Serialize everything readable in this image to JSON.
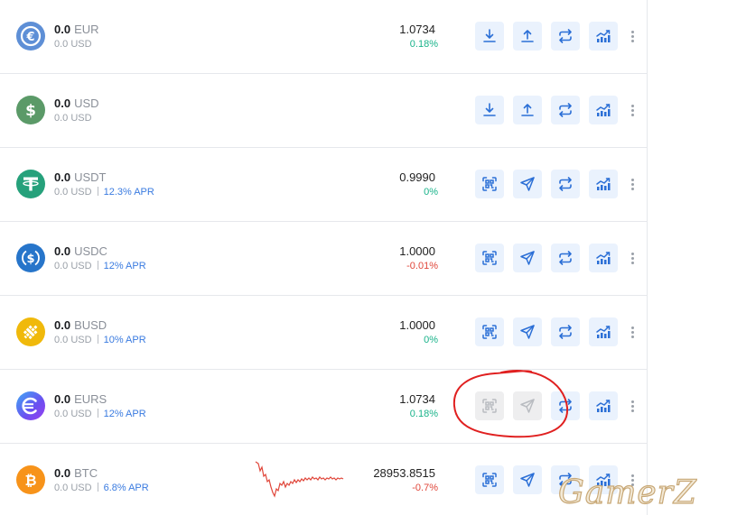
{
  "colors": {
    "accent": "#2b6fd6",
    "up": "#19b38a",
    "down": "#e0463a",
    "apr": "#3a7be0",
    "annotation": "#e02020"
  },
  "rows": [
    {
      "amount": "0.0",
      "symbol": "EUR",
      "usd": "0.0 USD",
      "apr": "",
      "price": "1.0734",
      "change": "0.18%",
      "trend": "up",
      "icon": "euro-coin-icon",
      "actions": [
        "deposit-icon",
        "withdraw-icon",
        "exchange-icon",
        "invest-chart-icon"
      ]
    },
    {
      "amount": "0.0",
      "symbol": "USD",
      "usd": "0.0 USD",
      "apr": "",
      "price": "",
      "change": "",
      "trend": "",
      "icon": "dollar-coin-icon",
      "actions": [
        "deposit-icon",
        "withdraw-icon",
        "exchange-icon",
        "invest-chart-icon"
      ]
    },
    {
      "amount": "0.0",
      "symbol": "USDT",
      "usd": "0.0 USD",
      "apr": "12.3% APR",
      "price": "0.9990",
      "change": "0%",
      "trend": "up",
      "icon": "tether-coin-icon",
      "actions": [
        "qr-receive-icon",
        "send-icon",
        "exchange-icon",
        "invest-chart-icon"
      ]
    },
    {
      "amount": "0.0",
      "symbol": "USDC",
      "usd": "0.0 USD",
      "apr": "12% APR",
      "price": "1.0000",
      "change": "-0.01%",
      "trend": "down",
      "icon": "usdc-coin-icon",
      "actions": [
        "qr-receive-icon",
        "send-icon",
        "exchange-icon",
        "invest-chart-icon"
      ]
    },
    {
      "amount": "0.0",
      "symbol": "BUSD",
      "usd": "0.0 USD",
      "apr": "10% APR",
      "price": "1.0000",
      "change": "0%",
      "trend": "up",
      "icon": "busd-coin-icon",
      "actions": [
        "qr-receive-icon",
        "send-icon",
        "exchange-icon",
        "invest-chart-icon"
      ]
    },
    {
      "amount": "0.0",
      "symbol": "EURS",
      "usd": "0.0 USD",
      "apr": "12% APR",
      "price": "1.0734",
      "change": "0.18%",
      "trend": "up",
      "icon": "eurs-coin-icon",
      "actions": [
        "qr-receive-icon",
        "send-icon",
        "exchange-icon",
        "invest-chart-icon"
      ],
      "disabled_actions": [
        0,
        1
      ]
    },
    {
      "amount": "0.0",
      "symbol": "BTC",
      "usd": "0.0 USD",
      "apr": "6.8% APR",
      "price": "28953.8515",
      "change": "-0.7%",
      "trend": "down",
      "icon": "bitcoin-coin-icon",
      "actions": [
        "qr-receive-icon",
        "send-icon",
        "exchange-icon",
        "invest-chart-icon"
      ]
    }
  ],
  "watermark": "GamerZ"
}
